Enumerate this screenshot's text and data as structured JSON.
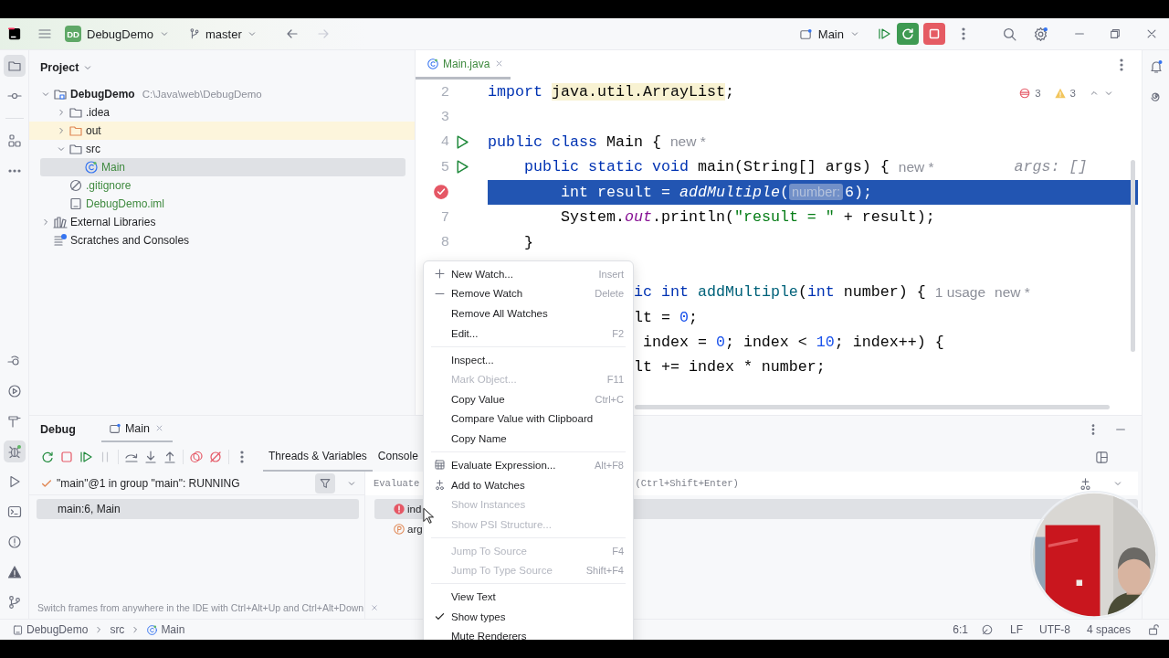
{
  "window": {
    "project_badge": "DD",
    "project": "DebugDemo",
    "branch": "master",
    "run_config": "Main"
  },
  "left_toolbar": {
    "top": [
      {
        "kind": "project",
        "selected": true
      },
      {
        "kind": "commit",
        "selected": false
      },
      {
        "kind": "structure",
        "selected": false
      },
      {
        "kind": "more",
        "selected": false
      }
    ],
    "bottom": [
      {
        "kind": "endpoints",
        "selected": false
      },
      {
        "kind": "services",
        "selected": false
      },
      {
        "kind": "build",
        "selected": false
      },
      {
        "kind": "debug",
        "selected": true
      },
      {
        "kind": "run",
        "selected": false
      },
      {
        "kind": "terminal",
        "selected": false
      },
      {
        "kind": "problems",
        "selected": false
      },
      {
        "kind": "warnings",
        "selected": false
      },
      {
        "kind": "git",
        "selected": false
      }
    ]
  },
  "project": {
    "title": "Project",
    "tree": [
      {
        "label": "DebugDemo",
        "kind": "module",
        "path": "C:\\Java\\web\\DebugDemo",
        "expanded": true,
        "selected": false,
        "added": false,
        "children": [
          {
            "label": ".idea",
            "kind": "folder",
            "expanded": false,
            "selected": false,
            "added": false
          },
          {
            "label": "out",
            "kind": "excluded-folder",
            "expanded": false,
            "selected": false,
            "added": false
          },
          {
            "label": "src",
            "kind": "folder",
            "expanded": true,
            "selected": false,
            "added": false,
            "children": [
              {
                "label": "Main",
                "kind": "class",
                "added": true,
                "selected": true
              }
            ]
          },
          {
            "label": ".gitignore",
            "kind": "ignore-file",
            "added": true,
            "selected": false
          },
          {
            "label": "DebugDemo.iml",
            "kind": "iml-file",
            "added": true,
            "selected": false
          }
        ]
      },
      {
        "label": "External Libraries",
        "kind": "libraries",
        "expanded": false,
        "selected": false,
        "added": false
      },
      {
        "label": "Scratches and Consoles",
        "kind": "scratches",
        "selected": false,
        "added": false
      }
    ]
  },
  "editor": {
    "tab": {
      "label": "Main.java",
      "added": true,
      "selected": true
    },
    "errors": "3",
    "warnings": "3",
    "lines": [
      {
        "kind": "code",
        "number": "2",
        "run_marker": false,
        "breakpoint": false,
        "segments": [
          {
            "kind": "keyword",
            "text": "import "
          },
          {
            "kind": "warn",
            "text": "java.util.ArrayList"
          },
          {
            "kind": "plain",
            "text": ";"
          }
        ]
      },
      {
        "kind": "blank",
        "number": "3",
        "run_marker": false,
        "breakpoint": false
      },
      {
        "kind": "code",
        "number": "4",
        "run_marker": true,
        "breakpoint": false,
        "segments": [
          {
            "kind": "keyword",
            "text": "public class"
          },
          {
            "kind": "plain",
            "text": " Main {"
          },
          {
            "kind": "hint",
            "text": "new *"
          }
        ]
      },
      {
        "kind": "code",
        "number": "5",
        "run_marker": true,
        "breakpoint": false,
        "segments": [
          {
            "kind": "keyword",
            "text": "    public static void"
          },
          {
            "kind": "plain",
            "text": " main(String[] args) {"
          },
          {
            "kind": "hint",
            "text": "new *"
          },
          {
            "kind": "value",
            "text": "args: []"
          }
        ]
      },
      {
        "kind": "code",
        "run_marker": false,
        "breakpoint": true,
        "highlighted": true,
        "segments": [
          {
            "kind": "keyword",
            "text": "        int"
          },
          {
            "kind": "plain",
            "text": " result = "
          },
          {
            "kind": "call",
            "text": "addMultiple"
          },
          {
            "kind": "plain",
            "text": "("
          },
          {
            "kind": "inlay",
            "text": "number:"
          },
          {
            "kind": "plain",
            "text": "6);"
          }
        ]
      },
      {
        "kind": "code",
        "number": "7",
        "run_marker": false,
        "breakpoint": false,
        "segments": [
          {
            "kind": "plain",
            "text": "        System."
          },
          {
            "kind": "field",
            "text": "out"
          },
          {
            "kind": "plain",
            "text": ".println("
          },
          {
            "kind": "string",
            "text": "\"result = \""
          },
          {
            "kind": "plain",
            "text": " + result);"
          }
        ]
      },
      {
        "kind": "code",
        "number": "8",
        "run_marker": false,
        "breakpoint": false,
        "segments": [
          {
            "kind": "plain",
            "text": "    }"
          }
        ]
      },
      {
        "kind": "blank"
      },
      {
        "kind": "code",
        "run_marker": false,
        "breakpoint": false,
        "segments": [
          {
            "kind": "keyword",
            "text": "                ic int"
          },
          {
            "kind": "decl",
            "text": " addMultiple"
          },
          {
            "kind": "plain",
            "text": "("
          },
          {
            "kind": "keyword",
            "text": "int"
          },
          {
            "kind": "plain",
            "text": " number) {"
          },
          {
            "kind": "hint",
            "text": "1 usage"
          },
          {
            "kind": "hint",
            "text": "new *"
          }
        ]
      },
      {
        "kind": "code",
        "run_marker": false,
        "breakpoint": false,
        "segments": [
          {
            "kind": "plain",
            "text": "                lt = "
          },
          {
            "kind": "number",
            "text": "0"
          },
          {
            "kind": "plain",
            "text": ";"
          }
        ]
      },
      {
        "kind": "code",
        "run_marker": false,
        "breakpoint": false,
        "segments": [
          {
            "kind": "plain",
            "text": "                 index = "
          },
          {
            "kind": "number",
            "text": "0"
          },
          {
            "kind": "plain",
            "text": "; index < "
          },
          {
            "kind": "number",
            "text": "10"
          },
          {
            "kind": "plain",
            "text": "; index++) {"
          }
        ]
      },
      {
        "kind": "code",
        "run_marker": false,
        "breakpoint": false,
        "segments": [
          {
            "kind": "plain",
            "text": "                lt += index * number;"
          }
        ]
      }
    ]
  },
  "debug": {
    "title": "Debug",
    "session_tab": {
      "label": "Main",
      "selected": true
    },
    "toolbar": [
      {
        "kind": "rerun",
        "disabled": false
      },
      {
        "kind": "stop",
        "disabled": false
      },
      {
        "kind": "resume",
        "disabled": false
      },
      {
        "kind": "pause",
        "disabled": true
      },
      {
        "kind": "step-over",
        "disabled": false
      },
      {
        "kind": "step-into",
        "disabled": false
      },
      {
        "kind": "step-out",
        "disabled": false
      },
      {
        "kind": "breakpoints",
        "disabled": false
      },
      {
        "kind": "mute",
        "disabled": false
      },
      {
        "kind": "more",
        "disabled": false
      }
    ],
    "tabs": [
      {
        "label": "Threads & Variables",
        "selected": true
      },
      {
        "label": "Console",
        "selected": false
      }
    ],
    "thread": "\"main\"@1 in group \"main\": RUNNING",
    "frames": [
      {
        "label": "main:6, Main",
        "selected": true
      }
    ],
    "evaluate": {
      "placeholder_parts": [
        "Evaluate",
        "(Ctrl+Shift+Enter)"
      ]
    },
    "variables": [
      {
        "kind": "error",
        "label": "ind",
        "selected": true
      },
      {
        "kind": "parameter",
        "label": "arg",
        "selected": false
      }
    ],
    "tip": "Switch frames from anywhere in the IDE with Ctrl+Alt+Up and Ctrl+Alt+Down"
  },
  "context_menu": [
    {
      "kind": "add",
      "label": "New Watch...",
      "shortcut": "Insert",
      "disabled": false,
      "checked": false
    },
    {
      "kind": "remove",
      "label": "Remove Watch",
      "shortcut": "Delete",
      "disabled": false,
      "checked": false
    },
    {
      "kind": "plain",
      "label": "Remove All Watches",
      "disabled": false,
      "checked": false
    },
    {
      "kind": "plain",
      "label": "Edit...",
      "shortcut": "F2",
      "disabled": false,
      "checked": false
    },
    {
      "kind": "separator"
    },
    {
      "kind": "plain",
      "label": "Inspect...",
      "disabled": false,
      "checked": false
    },
    {
      "kind": "plain",
      "label": "Mark Object...",
      "shortcut": "F11",
      "disabled": true,
      "checked": false
    },
    {
      "kind": "plain",
      "label": "Copy Value",
      "shortcut": "Ctrl+C",
      "disabled": false,
      "checked": false
    },
    {
      "kind": "plain",
      "label": "Compare Value with Clipboard",
      "disabled": false,
      "checked": false
    },
    {
      "kind": "plain",
      "label": "Copy Name",
      "disabled": false,
      "checked": false
    },
    {
      "kind": "separator"
    },
    {
      "kind": "evaluate",
      "label": "Evaluate Expression...",
      "shortcut": "Alt+F8",
      "disabled": false,
      "checked": false
    },
    {
      "kind": "watch",
      "label": "Add to Watches",
      "disabled": false,
      "checked": false
    },
    {
      "kind": "plain",
      "label": "Show Instances",
      "disabled": true,
      "checked": false
    },
    {
      "kind": "plain",
      "label": "Show PSI Structure...",
      "disabled": true,
      "checked": false
    },
    {
      "kind": "separator"
    },
    {
      "kind": "plain",
      "label": "Jump To Source",
      "shortcut": "F4",
      "disabled": true,
      "checked": false
    },
    {
      "kind": "plain",
      "label": "Jump To Type Source",
      "shortcut": "Shift+F4",
      "disabled": true,
      "checked": false
    },
    {
      "kind": "separator"
    },
    {
      "kind": "plain",
      "label": "View Text",
      "disabled": false,
      "checked": false
    },
    {
      "kind": "plain",
      "label": "Show types",
      "disabled": false,
      "checked": true
    },
    {
      "kind": "plain",
      "label": "Mute Renderers",
      "disabled": false,
      "checked": false
    }
  ],
  "status_bar": {
    "breadcrumbs": [
      {
        "kind": "module",
        "label": "DebugDemo"
      },
      {
        "kind": "folder",
        "label": "src"
      },
      {
        "kind": "class",
        "label": "Main"
      }
    ],
    "position": "6:1",
    "line_separator": "LF",
    "encoding": "UTF-8",
    "indent": "4 spaces"
  }
}
